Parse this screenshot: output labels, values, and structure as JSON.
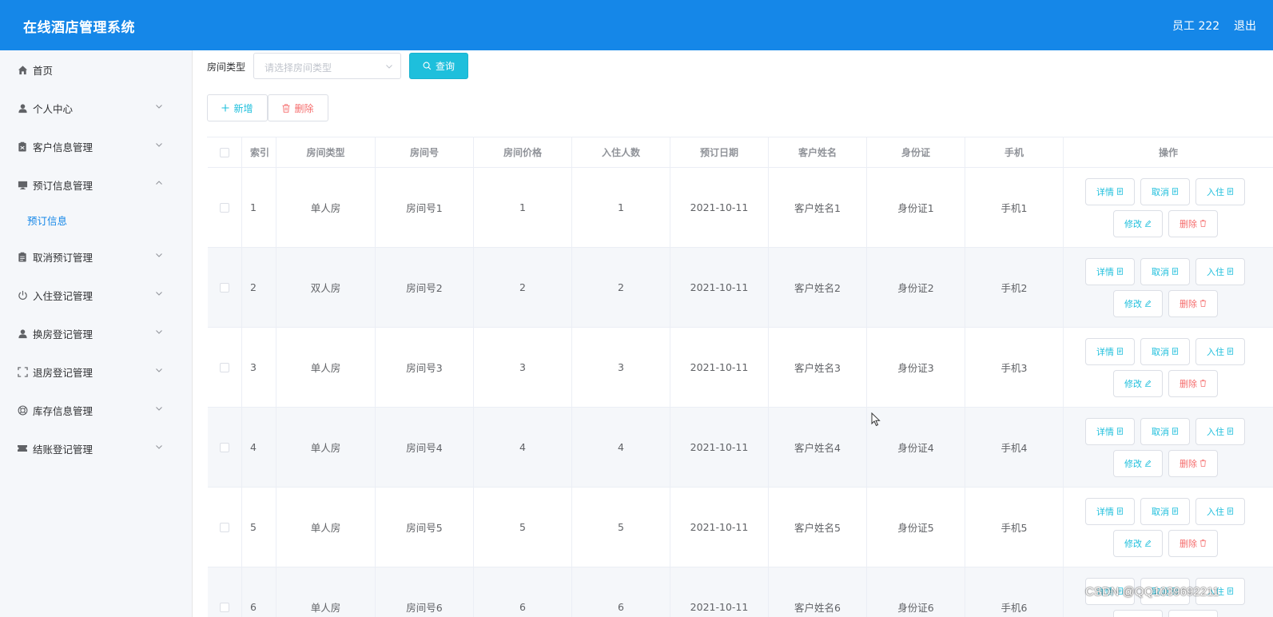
{
  "header": {
    "title": "在线酒店管理系统",
    "user": "员工 222",
    "logout": "退出"
  },
  "sidebar": {
    "items": [
      {
        "label": "首页",
        "icon": "home-icon"
      },
      {
        "label": "个人中心",
        "icon": "user-icon"
      },
      {
        "label": "客户信息管理",
        "icon": "clipboard-icon"
      },
      {
        "label": "预订信息管理",
        "icon": "monitor-icon"
      },
      {
        "label": "取消预订管理",
        "icon": "clipboard-icon"
      },
      {
        "label": "入住登记管理",
        "icon": "power-icon"
      },
      {
        "label": "换房登记管理",
        "icon": "user-icon"
      },
      {
        "label": "退房登记管理",
        "icon": "fullscreen-icon"
      },
      {
        "label": "库存信息管理",
        "icon": "lifebuoy-icon"
      },
      {
        "label": "结账登记管理",
        "icon": "ticket-icon"
      }
    ],
    "subitem": "预订信息"
  },
  "filter": {
    "label": "房间类型",
    "placeholder": "请选择房间类型",
    "query": "查询"
  },
  "actions": {
    "add": "新增",
    "delete": "删除"
  },
  "table": {
    "headers": [
      "索引",
      "房间类型",
      "房间号",
      "房间价格",
      "入住人数",
      "预订日期",
      "客户姓名",
      "身份证",
      "手机",
      "操作"
    ],
    "rows": [
      [
        "1",
        "单人房",
        "房间号1",
        "1",
        "1",
        "2021-10-11",
        "客户姓名1",
        "身份证1",
        "手机1"
      ],
      [
        "2",
        "双人房",
        "房间号2",
        "2",
        "2",
        "2021-10-11",
        "客户姓名2",
        "身份证2",
        "手机2"
      ],
      [
        "3",
        "单人房",
        "房间号3",
        "3",
        "3",
        "2021-10-11",
        "客户姓名3",
        "身份证3",
        "手机3"
      ],
      [
        "4",
        "单人房",
        "房间号4",
        "4",
        "4",
        "2021-10-11",
        "客户姓名4",
        "身份证4",
        "手机4"
      ],
      [
        "5",
        "单人房",
        "房间号5",
        "5",
        "5",
        "2021-10-11",
        "客户姓名5",
        "身份证5",
        "手机5"
      ],
      [
        "6",
        "单人房",
        "房间号6",
        "6",
        "6",
        "2021-10-11",
        "客户姓名6",
        "身份证6",
        "手机6"
      ]
    ],
    "ops": {
      "detail": "详情",
      "cancel": "取消",
      "checkin": "入住",
      "edit": "修改",
      "remove": "删除"
    }
  },
  "watermark": "CSDN @QQ1039692211",
  "colors": {
    "header_bg": "#1587e8",
    "accent": "#1ebfdc",
    "danger": "#f56c6c"
  }
}
